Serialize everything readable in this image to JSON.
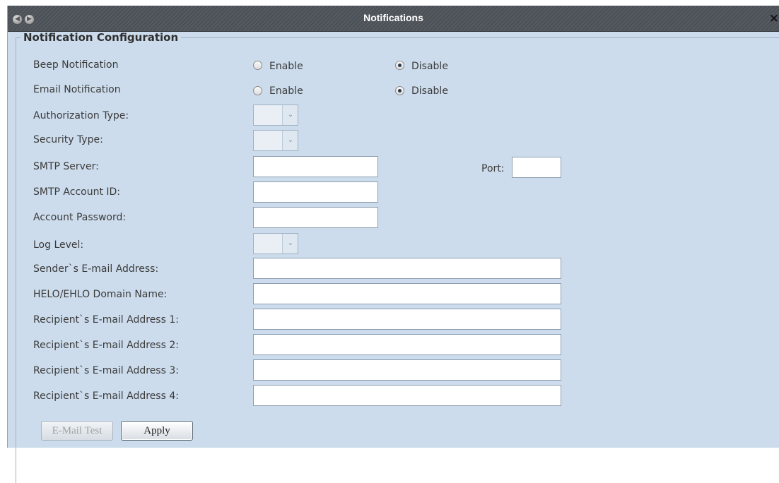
{
  "window": {
    "title": "Notifications",
    "close_glyph": "×",
    "back_icon": "arrow-left-icon",
    "forward_icon": "arrow-right-icon"
  },
  "group": {
    "legend": "Notification Configuration"
  },
  "beep": {
    "label": "Beep Notification",
    "enable_label": "Enable",
    "disable_label": "Disable",
    "selected": "Disable"
  },
  "email": {
    "label": "Email Notification",
    "enable_label": "Enable",
    "disable_label": "Disable",
    "selected": "Disable"
  },
  "auth_type": {
    "label": "Authorization Type:",
    "value": ""
  },
  "security_type": {
    "label": "Security Type:",
    "value": ""
  },
  "smtp_server": {
    "label": "SMTP Server:",
    "value": ""
  },
  "port": {
    "label": "Port:",
    "value": ""
  },
  "smtp_account": {
    "label": "SMTP Account ID:",
    "value": ""
  },
  "account_password": {
    "label": "Account Password:",
    "value": ""
  },
  "log_level": {
    "label": "Log Level:",
    "value": ""
  },
  "sender_email": {
    "label": "Sender`s E-mail Address:",
    "value": ""
  },
  "helo_domain": {
    "label": "HELO/EHLO Domain Name:",
    "value": ""
  },
  "recipients": [
    {
      "label": "Recipient`s E-mail Address 1:",
      "value": ""
    },
    {
      "label": "Recipient`s E-mail Address 2:",
      "value": ""
    },
    {
      "label": "Recipient`s E-mail Address 3:",
      "value": ""
    },
    {
      "label": "Recipient`s E-mail Address 4:",
      "value": ""
    }
  ],
  "buttons": {
    "email_test": "E-Mail Test",
    "apply": "Apply"
  },
  "colors": {
    "panel_bg": "#ccdcec",
    "titlebar": "#565b61",
    "title_text": "#ffffff"
  }
}
